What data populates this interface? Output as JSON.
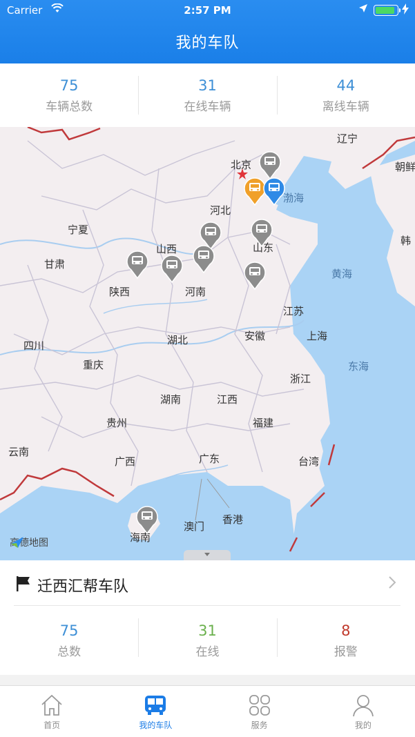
{
  "status": {
    "carrier": "Carrier",
    "time": "2:57 PM",
    "battery_level": 0.9
  },
  "nav": {
    "title": "我的车队"
  },
  "summary": [
    {
      "value": "75",
      "label": "车辆总数"
    },
    {
      "value": "31",
      "label": "在线车辆"
    },
    {
      "value": "44",
      "label": "离线车辆"
    }
  ],
  "map": {
    "labels": {
      "liaoning": "辽宁",
      "beijing": "北京",
      "bohai": "渤海",
      "chaoxian": "朝鲜",
      "hebei": "河北",
      "ningxia": "宁夏",
      "shanxi": "山西",
      "shandong": "山东",
      "han": "韩",
      "gansu": "甘肃",
      "huanghai": "黄海",
      "shaanxi": "陕西",
      "henan": "河南",
      "jiangsu": "江苏",
      "sichuan": "四川",
      "hubei": "湖北",
      "anhui": "安徽",
      "shanghai": "上海",
      "chongqing": "重庆",
      "donghai": "东海",
      "zhejiang": "浙江",
      "hunan": "湖南",
      "jiangxi": "江西",
      "guizhou": "贵州",
      "fujian": "福建",
      "yunnan": "云南",
      "guangxi": "广西",
      "guangdong": "广东",
      "taiwan": "台湾",
      "xianggang": "香港",
      "aomen": "澳门",
      "hainan": "海南"
    },
    "logo_text": "高德地图",
    "colors": {
      "land": "#f3eef0",
      "sea": "#aad3f5",
      "border": "#c9c4d6",
      "national_border": "#c0393b",
      "river": "#a8cdf0",
      "pin_gray": "#8c8c8c",
      "pin_orange": "#f0a02a",
      "pin_blue": "#2f8ae6"
    }
  },
  "fleet": {
    "name": "迁西汇帮车队",
    "stats": [
      {
        "value": "75",
        "label": "总数",
        "color": "#3d8fd6"
      },
      {
        "value": "31",
        "label": "在线",
        "color": "#6ab04c"
      },
      {
        "value": "8",
        "label": "报警",
        "color": "#c0392b"
      }
    ]
  },
  "tabs": [
    {
      "label": "首页",
      "icon": "home-icon"
    },
    {
      "label": "我的车队",
      "icon": "bus-icon",
      "active": true
    },
    {
      "label": "服务",
      "icon": "grid-icon"
    },
    {
      "label": "我的",
      "icon": "person-icon"
    }
  ]
}
